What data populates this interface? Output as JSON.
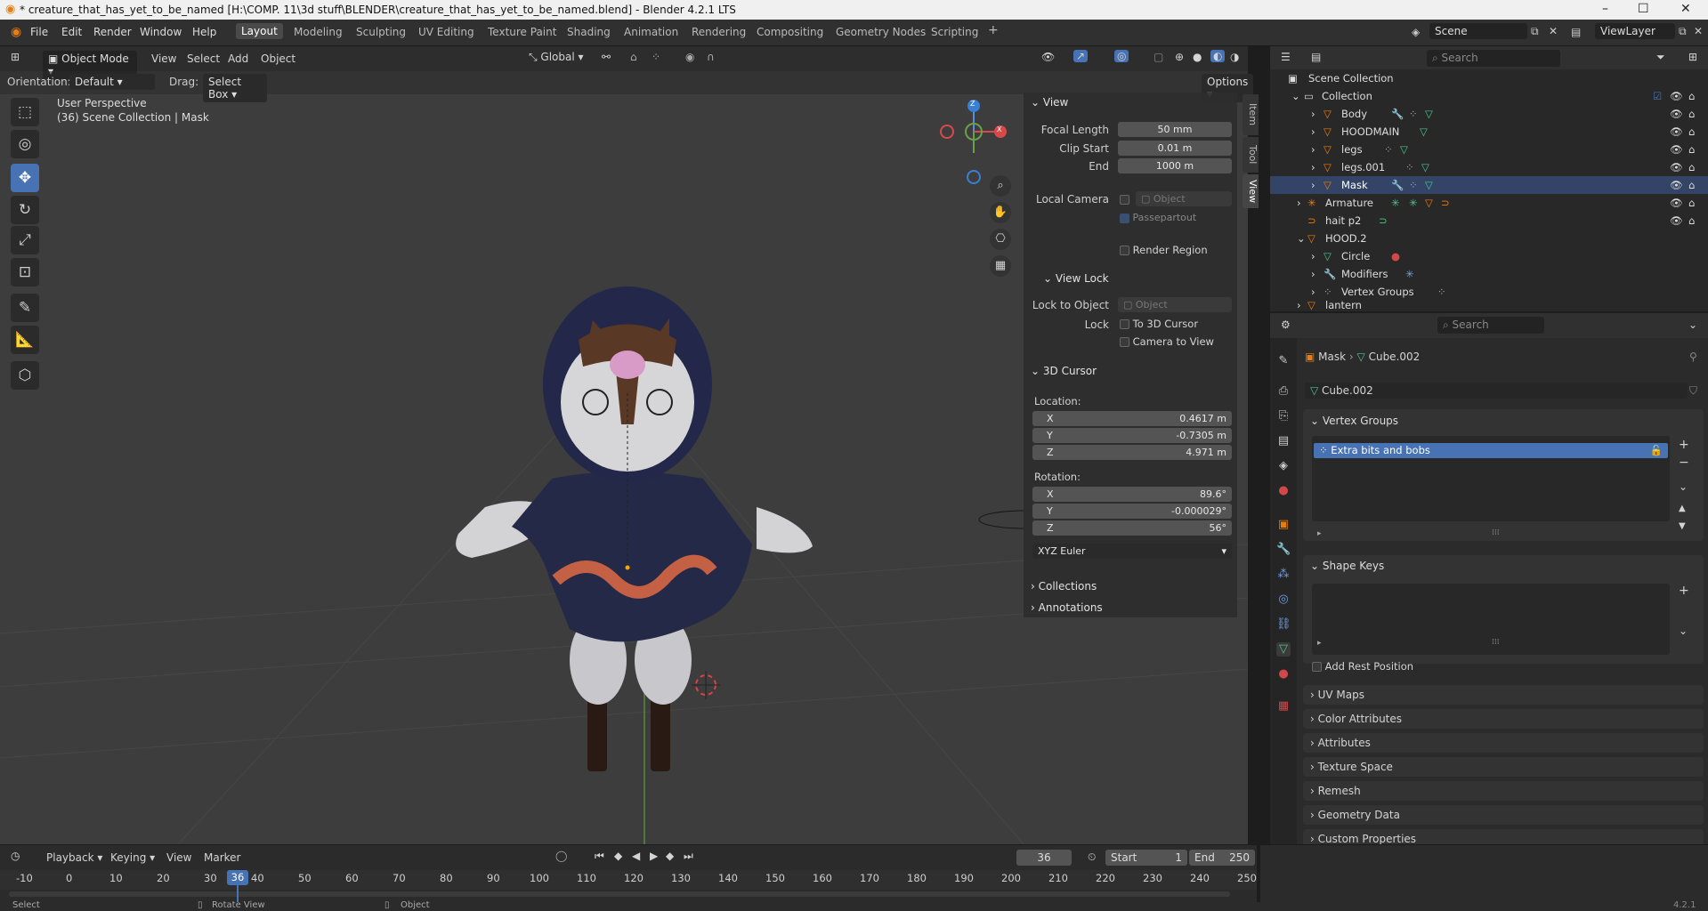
{
  "window": {
    "title": "* creature_that_has_yet_to_be_named [H:\\COMP. 11\\3d stuff\\BLENDER\\creature_that_has_yet_to_be_named.blend] - Blender 4.2.1 LTS",
    "minimize": "–",
    "maximize": "☐",
    "close": "✕"
  },
  "menu": [
    "File",
    "Edit",
    "Render",
    "Window",
    "Help"
  ],
  "workspaces": [
    "Layout",
    "Modeling",
    "Sculpting",
    "UV Editing",
    "Texture Paint",
    "Shading",
    "Animation",
    "Rendering",
    "Compositing",
    "Geometry Nodes",
    "Scripting"
  ],
  "active_workspace": "Layout",
  "scene": "Scene",
  "view_layer": "ViewLayer",
  "viewport": {
    "mode": "Object Mode",
    "menus": [
      "View",
      "Select",
      "Add",
      "Object"
    ],
    "transform_orientation": "Global",
    "orientation_label": "Orientation:",
    "orientation_value": "Default",
    "drag_label": "Drag:",
    "drag_value": "Select Box",
    "options": "Options",
    "perspective": "User Perspective",
    "context": "(36) Scene Collection | Mask",
    "gizmo_x": "X",
    "gizmo_y": "Y",
    "gizmo_z": "Z"
  },
  "npanel": {
    "tabs": [
      "Item",
      "Tool",
      "View"
    ],
    "view_section": "View",
    "focal_length_label": "Focal Length",
    "focal_length": "50 mm",
    "clip_start_label": "Clip Start",
    "clip_start": "0.01 m",
    "end_label": "End",
    "clip_end": "1000 m",
    "local_camera_label": "Local Camera",
    "object_placeholder": "Object",
    "passepartout": "Passepartout",
    "render_region": "Render Region",
    "view_lock": "View Lock",
    "lock_to_object_label": "Lock to Object",
    "lock_label": "Lock",
    "to_3d_cursor": "To 3D Cursor",
    "camera_to_view": "Camera to View",
    "cursor_section": "3D Cursor",
    "location_label": "Location:",
    "loc_x": "0.4617 m",
    "loc_y": "-0.7305 m",
    "loc_z": "4.971 m",
    "rotation_label": "Rotation:",
    "rot_x": "89.6°",
    "rot_y": "-0.000029°",
    "rot_z": "56°",
    "rotation_mode": "XYZ Euler",
    "collections": "Collections",
    "annotations": "Annotations",
    "axis_x": "X",
    "axis_y": "Y",
    "axis_z": "Z"
  },
  "outliner": {
    "search_placeholder": "Search",
    "root": "Scene Collection",
    "items": [
      {
        "label": "Collection",
        "level": 0
      },
      {
        "label": "Body",
        "level": 1
      },
      {
        "label": "HOODMAIN",
        "level": 1
      },
      {
        "label": "legs",
        "level": 1
      },
      {
        "label": "legs.001",
        "level": 1
      },
      {
        "label": "Mask",
        "level": 1
      },
      {
        "label": "Armature",
        "level": 0
      },
      {
        "label": "hait p2",
        "level": 0
      },
      {
        "label": "HOOD.2",
        "level": 0
      },
      {
        "label": "Circle",
        "level": 1
      },
      {
        "label": "Modifiers",
        "level": 1
      },
      {
        "label": "Vertex Groups",
        "level": 1
      },
      {
        "label": "lantern",
        "level": 0
      }
    ]
  },
  "properties": {
    "search_placeholder": "Search",
    "breadcrumb_object": "Mask",
    "breadcrumb_data": "Cube.002",
    "data_name": "Cube.002",
    "vertex_groups": "Vertex Groups",
    "vertex_group_item": "Extra bits and bobs",
    "shape_keys": "Shape Keys",
    "add_rest_position": "Add Rest Position",
    "sections": [
      "UV Maps",
      "Color Attributes",
      "Attributes",
      "Texture Space",
      "Remesh",
      "Geometry Data",
      "Custom Properties"
    ]
  },
  "timeline": {
    "menus": [
      "Playback",
      "Keying",
      "View",
      "Marker"
    ],
    "current_frame": "36",
    "start_label": "Start",
    "start": "1",
    "end_label": "End",
    "end": "250",
    "ticks": [
      "-10",
      "0",
      "10",
      "20",
      "30",
      "40",
      "50",
      "60",
      "70",
      "80",
      "90",
      "100",
      "110",
      "120",
      "130",
      "140",
      "150",
      "160",
      "170",
      "180",
      "190",
      "200",
      "210",
      "220",
      "230",
      "240",
      "250"
    ]
  },
  "statusbar": {
    "select": "Select",
    "rotate": "Rotate View",
    "object": "Object",
    "version": "4.2.1"
  },
  "colors": {
    "accent": "#4772b3",
    "viewport_bg": "#3d3d3d",
    "panel_bg": "#2b2b2b",
    "object_orange": "#e87d0d",
    "mesh_green": "#4bc48c"
  }
}
